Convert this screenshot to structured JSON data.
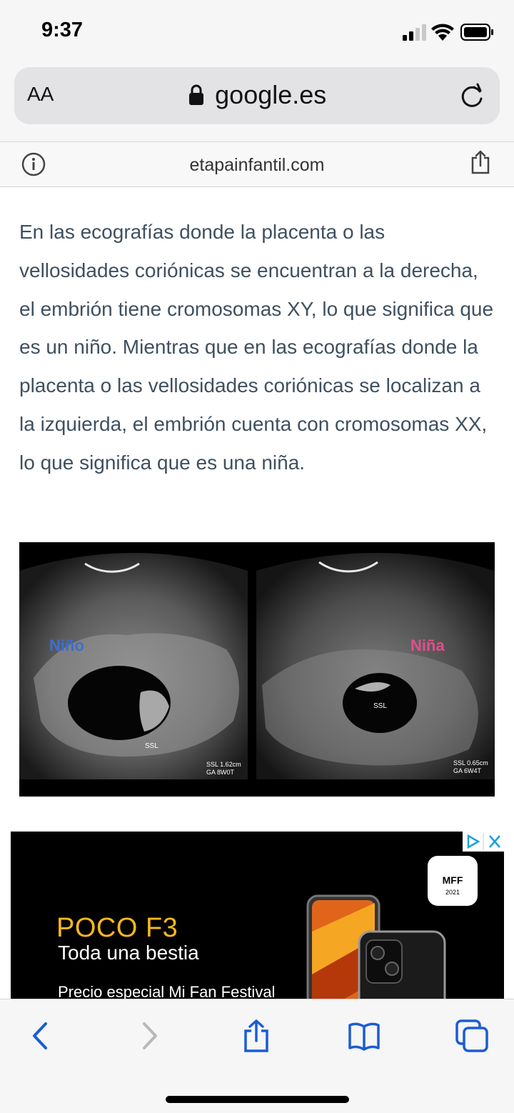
{
  "status_bar": {
    "time": "9:37",
    "icons": [
      "cellular-signal-icon",
      "wifi-icon",
      "battery-icon"
    ]
  },
  "browser": {
    "text_size_label": "AA",
    "url": "google.es",
    "site_domain": "etapainfantil.com",
    "icons": [
      "lock-icon",
      "reload-icon",
      "info-icon",
      "share-icon"
    ]
  },
  "article": {
    "paragraph": "En las ecografías donde la placenta o las vellosidades coriónicas se encuentran a la derecha, el embrión tiene cromosomas XY, lo que significa que es un niño. Mientras que en las ecografías donde la placenta o las vellosidades coriónicas se localizan a la izquierda, el embrión cuenta con cromosomas XX, lo que significa que es una niña.",
    "text_color": "#3f5060"
  },
  "ultrasound": {
    "left_label": "Niño",
    "left_label_color": "#3a6fd8",
    "left_marker": "SSL",
    "left_readout_line1": "SSL 1.62cm",
    "left_readout_line2": "GA   8W0T",
    "right_label": "Niña",
    "right_label_color": "#e0508a",
    "right_marker": "SSL",
    "right_readout_line1": "SSL 0.65cm",
    "right_readout_line2": "GA   6W4T"
  },
  "ad": {
    "logo_text": "MFF",
    "logo_year": "2021",
    "title": "POCO F3",
    "subtitle": "Toda una bestia",
    "promo": "Precio especial Mi Fan Festival",
    "title_color": "#f6b81c"
  },
  "toolbar": {
    "buttons": [
      "back-icon",
      "forward-icon",
      "share-icon",
      "bookmarks-icon",
      "tabs-icon"
    ],
    "accent_color": "#1a5cd6"
  }
}
